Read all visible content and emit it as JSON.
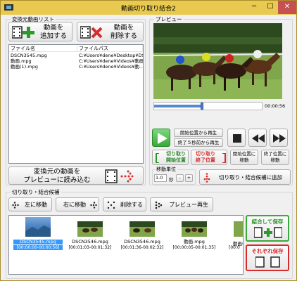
{
  "window": {
    "title": "動画切り取り結合2",
    "min": "─",
    "max": "☐",
    "close": "✕"
  },
  "source": {
    "group_label": "変換元動画リスト",
    "add_label": "動画を\n追加する",
    "delete_label": "動画を\n削除する",
    "columns": [
      "ファイル名",
      "ファイルパス"
    ],
    "rows": [
      {
        "name": "DSCN3545.mpg",
        "path": "C:¥Users¥dene¥Desktop¥DS..."
      },
      {
        "name": "動画.mpg",
        "path": "C:¥Users¥dene¥Videos¥動画..."
      },
      {
        "name": "動画(1).mpg",
        "path": "C:¥Users¥dene¥Videos¥動..."
      }
    ],
    "load_label": "変換元の動画を\nプレビューに読み込む"
  },
  "preview": {
    "group_label": "プレビュー",
    "time": "00:00:56",
    "progress": 0.43,
    "play_from_pos": "開始位置から再生",
    "play_last5": "終了５秒前から再生",
    "cut_start": "切り取り\n開始位置",
    "cut_end": "切り取り\n終了位置",
    "move_start": "開始位置に\n移動",
    "move_end": "終了位置に\n移動",
    "unit_label": "移動単位",
    "unit_value": "1.0",
    "unit_suffix": "秒",
    "minus": "-",
    "plus": "+",
    "add_candidate": "切り取り・結合候補に追加"
  },
  "candidates": {
    "group_label": "切り取り・結合候補",
    "move_left": "左に移動",
    "move_right": "右に移動",
    "delete": "削除する",
    "preview_play": "プレビュー再生",
    "items": [
      {
        "name": "DSCN3545.mpg",
        "time": "[00:00:00-00:00:56]",
        "selected": true
      },
      {
        "name": "DSCN3546.mpg",
        "time": "[00:01:03-00:01:32]",
        "selected": false
      },
      {
        "name": "DSCN3546.mpg",
        "time": "[00:01:36-00:02:32]",
        "selected": false
      },
      {
        "name": "動画.mpg",
        "time": "[00:00:05-00:01:35]",
        "selected": false
      },
      {
        "name": "動画(",
        "time": "[00:0",
        "selected": false
      }
    ],
    "save_join": "結合して保存",
    "save_each": "それぞれ保存"
  },
  "colors": {
    "titlebar": "#e9c94f",
    "green": "#3aa83a",
    "red": "#d82b2b",
    "selection": "#3399ff"
  }
}
